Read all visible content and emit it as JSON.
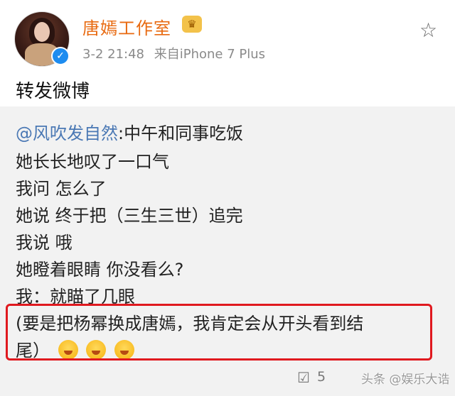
{
  "post": {
    "username": "唐嫣工作室",
    "vip_badge": "♛",
    "timestamp": "3-2 21:48",
    "source": "来自iPhone 7 Plus",
    "repost_text": "转发微博",
    "star_icon": "star-icon"
  },
  "quoted": {
    "mention": "@风吹发自然",
    "first_line_rest": ":中午和同事吃饭",
    "lines": [
      "她长长地叹了一口气",
      "我问 怎么了",
      "她说 终于把（三生三世）追完",
      "我说 哦",
      "她瞪着眼睛 你没看么?",
      "我：就瞄了几眼",
      "(要是把杨幂换成唐嫣，我肯定会从开头看到结",
      "尾）"
    ]
  },
  "footer": {
    "repost_count": "5",
    "watermark": "头条 @娱乐大诰"
  },
  "colors": {
    "username": "#e86a10",
    "mention": "#4a78b4",
    "highlight": "#e0191f",
    "quoted_bg": "#f2f2f2"
  }
}
